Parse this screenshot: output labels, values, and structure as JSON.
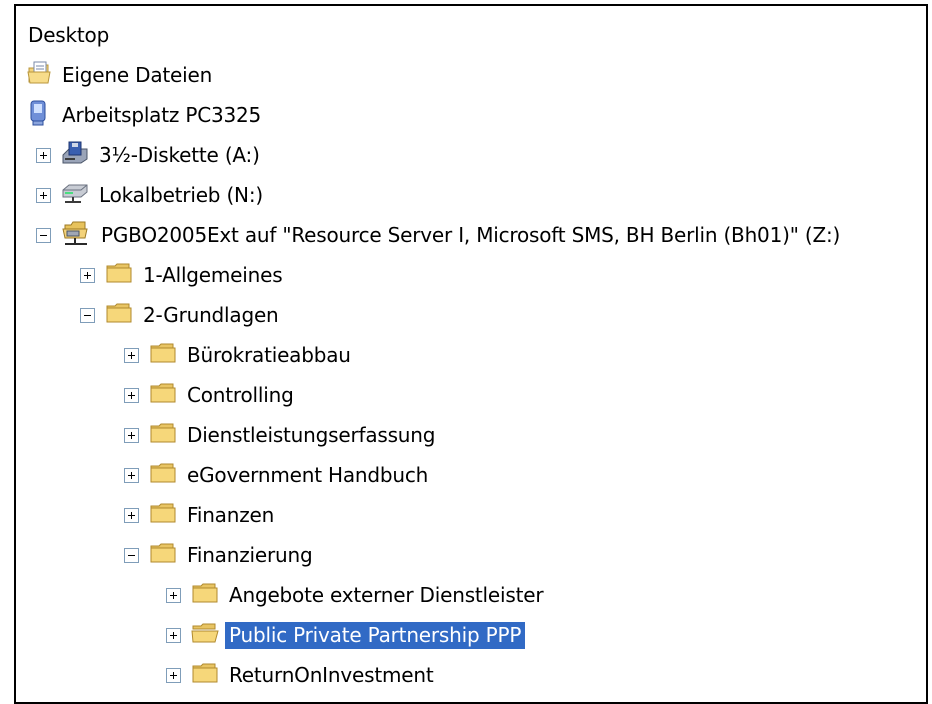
{
  "tree": {
    "root": "Desktop",
    "items": [
      {
        "label": "Eigene Dateien",
        "icon": "my-documents-icon"
      },
      {
        "label": "Arbeitsplatz PC3325",
        "icon": "my-computer-icon"
      },
      {
        "label": "3½-Diskette (A:)",
        "icon": "floppy-drive-icon",
        "expander": "+"
      },
      {
        "label": "Lokalbetrieb (N:)",
        "icon": "network-drive-icon",
        "expander": "+"
      },
      {
        "label": "PGBO2005Ext auf \"Resource Server I, Microsoft SMS, BH Berlin (Bh01)\" (Z:)",
        "icon": "network-share-icon",
        "expander": "-"
      },
      {
        "label": "1-Allgemeines",
        "icon": "folder-icon",
        "expander": "+"
      },
      {
        "label": "2-Grundlagen",
        "icon": "folder-icon",
        "expander": "-"
      },
      {
        "label": "Bürokratieabbau",
        "icon": "folder-icon",
        "expander": "+"
      },
      {
        "label": "Controlling",
        "icon": "folder-icon",
        "expander": "+"
      },
      {
        "label": "Dienstleistungserfassung",
        "icon": "folder-icon",
        "expander": "+"
      },
      {
        "label": "eGovernment Handbuch",
        "icon": "folder-icon",
        "expander": "+"
      },
      {
        "label": "Finanzen",
        "icon": "folder-icon",
        "expander": "+"
      },
      {
        "label": "Finanzierung",
        "icon": "folder-icon",
        "expander": "-"
      },
      {
        "label": "Angebote externer Dienstleister",
        "icon": "folder-icon",
        "expander": "+"
      },
      {
        "label": "Public Private Partnership PPP",
        "icon": "folder-icon",
        "expander": "+",
        "selected": true
      },
      {
        "label": "ReturnOnInvestment",
        "icon": "folder-icon",
        "expander": "+"
      }
    ]
  },
  "colors": {
    "selection": "#316ac5",
    "folder": "#f3d27a",
    "expander_border": "#7f9db9"
  }
}
